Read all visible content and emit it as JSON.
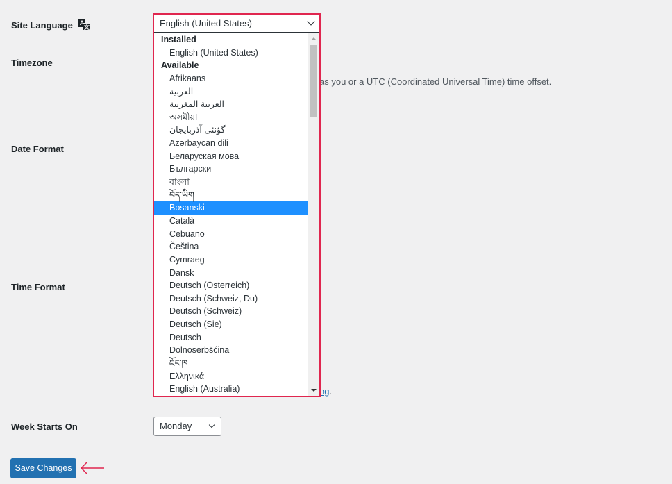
{
  "labels": {
    "site_language": "Site Language",
    "timezone": "Timezone",
    "date_format": "Date Format",
    "time_format": "Time Format",
    "week_starts_on": "Week Starts On"
  },
  "language_icon": "translation-icon",
  "site_language_select": {
    "selected_value": "English (United States)",
    "groups": [
      {
        "label": "Installed",
        "options": [
          "English (United States)"
        ]
      },
      {
        "label": "Available",
        "options": [
          "Afrikaans",
          "العربية",
          "العربية المغربية",
          "অসমীয়া",
          "گؤنئی آذربایجان",
          "Azərbaycan dili",
          "Беларуская мова",
          "Български",
          "বাংলা",
          "བོད་ཡིག",
          "Bosanski",
          "Català",
          "Cebuano",
          "Čeština",
          "Cymraeg",
          "Dansk",
          "Deutsch (Österreich)",
          "Deutsch (Schweiz, Du)",
          "Deutsch (Schweiz)",
          "Deutsch (Sie)",
          "Deutsch",
          "Dolnoserbšćina",
          "ཇོང་ཁ",
          "Ελληνικά",
          "English (Australia)"
        ]
      }
    ],
    "highlighted_option": "Bosanski",
    "scroll_position": 0.0
  },
  "timezone_description_visible": "as you or a UTC (Coordinated Universal Time) time offset.",
  "date_time_doc_link_visible": "ng",
  "date_time_doc_suffix": ".",
  "week_starts_on_select": {
    "selected_value": "Monday"
  },
  "save_button": {
    "label": "Save Changes"
  },
  "colors": {
    "annotation": "#e0264f",
    "primary": "#2271b1",
    "highlight": "#1e90ff"
  }
}
